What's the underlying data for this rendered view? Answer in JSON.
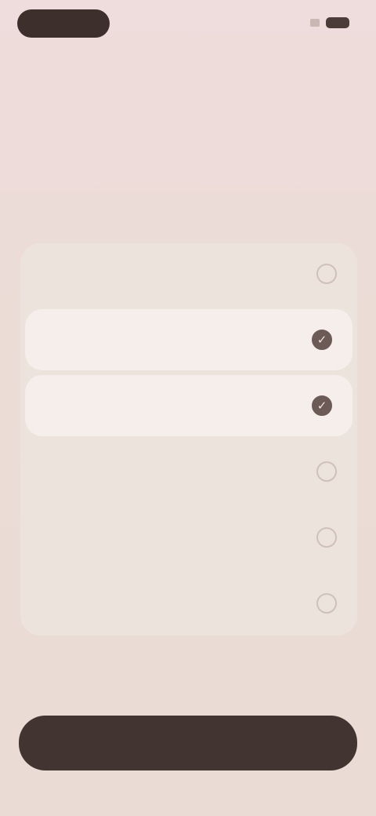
{
  "status_bar": {
    "icons": [
      "signal-icon",
      "battery-icon"
    ]
  },
  "header": {
    "skip_label": ""
  },
  "main": {
    "title": "",
    "subtitle": "",
    "options": [
      {
        "label": "",
        "selected": false
      },
      {
        "label": "",
        "selected": true
      },
      {
        "label": "",
        "selected": true
      },
      {
        "label": "",
        "selected": false
      },
      {
        "label": "",
        "selected": false
      },
      {
        "label": "",
        "selected": false
      }
    ],
    "check_glyph": "✓"
  },
  "footer": {
    "continue_label": ""
  },
  "colors": {
    "background": "#ebdcd6",
    "panel": "#ede3dd",
    "selected_row": "#f5eeeb",
    "primary_button": "#423431",
    "accent_dark": "#6b5a56"
  }
}
